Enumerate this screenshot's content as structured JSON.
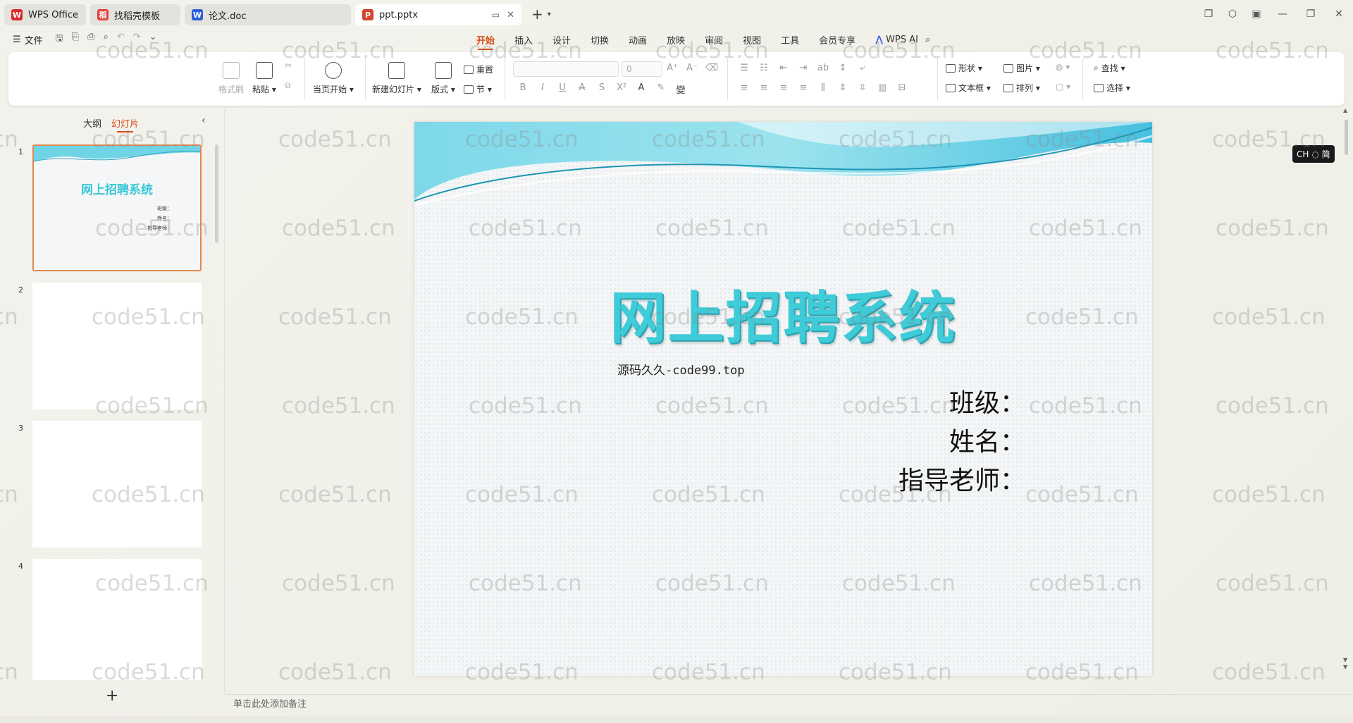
{
  "tabs": [
    {
      "label": "WPS Office",
      "icon": "wps-logo-icon",
      "color": "#d92b2b"
    },
    {
      "label": "找稻壳模板",
      "icon": "docer-icon",
      "color": "#e0413a"
    },
    {
      "label": "论文.doc",
      "icon": "word-doc-icon",
      "color": "#2b5fd9"
    },
    {
      "label": "ppt.pptx",
      "icon": "ppt-icon",
      "color": "#d2472c",
      "active": true
    }
  ],
  "menu": {
    "file_label": "文件",
    "ribbon_tabs": [
      "开始",
      "插入",
      "设计",
      "切换",
      "动画",
      "放映",
      "审阅",
      "视图",
      "工具",
      "会员专享"
    ],
    "active_tab": "开始",
    "wps_ai_label": "WPS AI"
  },
  "ribbon": {
    "format_painter": "格式刷",
    "paste": "粘贴",
    "start_from_current": "当页开始",
    "new_slide": "新建幻灯片",
    "layout": "版式",
    "reset": "重置",
    "section": "节",
    "font_size": "0",
    "shape": "形状",
    "picture": "图片",
    "textbox": "文本框",
    "arrange": "排列",
    "find": "查找",
    "select": "选择"
  },
  "panel": {
    "view_outline": "大纲",
    "view_slides": "幻灯片",
    "thumb_title": "网上招聘系统",
    "thumb_lines": [
      "班级：",
      "姓名：",
      "指导老师："
    ],
    "slide_numbers": [
      "1",
      "2",
      "3",
      "4"
    ]
  },
  "slide": {
    "title": "网上招聘系统",
    "subtitle": "源码久久-code99.top",
    "lines": [
      "班级：",
      "姓名：",
      "指导老师："
    ],
    "accent_color": "#3fcbd8"
  },
  "ime_label": "CH ◌ 简",
  "notes_placeholder": "单击此处添加备注",
  "watermark_text": "code51.cn"
}
